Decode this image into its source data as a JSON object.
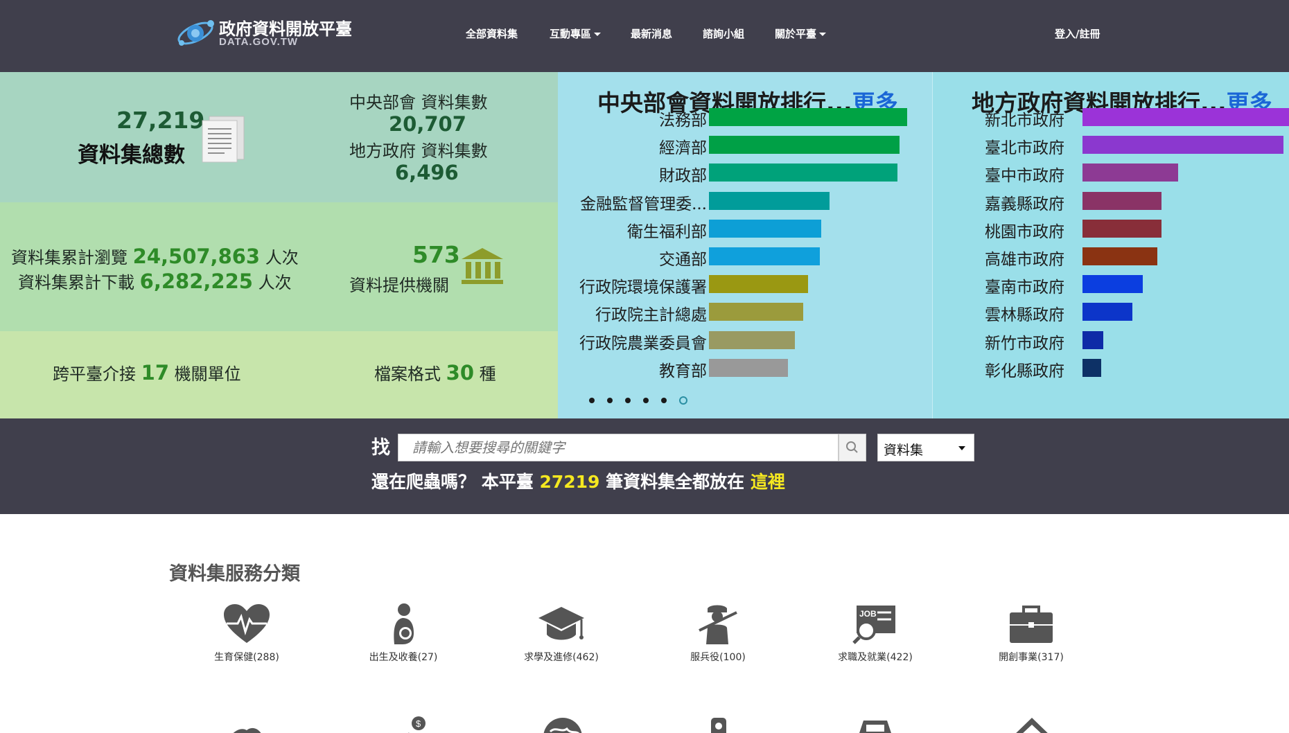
{
  "header": {
    "logo_title": "政府資料開放平臺",
    "logo_sub": "DATA.GOV.TW",
    "nav": [
      {
        "label": "全部資料集",
        "has_caret": false
      },
      {
        "label": "互動專區",
        "has_caret": true
      },
      {
        "label": "最新消息",
        "has_caret": false
      },
      {
        "label": "諮詢小組",
        "has_caret": false
      },
      {
        "label": "關於平臺",
        "has_caret": true
      }
    ],
    "login": "登入/註冊"
  },
  "stats": {
    "total_value": "27,219",
    "total_label": "資料集總數",
    "central_label": "中央部會 資料集數",
    "central_value": "20,707",
    "local_label": "地方政府 資料集數",
    "local_value": "6,496",
    "views_prefix": "資料集累計瀏覽",
    "views_value": "24,507,863",
    "views_suffix": "人次",
    "downloads_prefix": "資料集累計下載",
    "downloads_value": "6,282,225",
    "downloads_suffix": "人次",
    "agencies_value": "573",
    "agencies_label": "資料提供機關",
    "cross_prefix": "跨平臺介接",
    "cross_value": "17",
    "cross_suffix": "機關單位",
    "format_prefix": "檔案格式",
    "format_value": "30",
    "format_suffix": "種"
  },
  "ranking_central": {
    "title": "中央部會資料開放排行...",
    "more": "更多",
    "items": [
      {
        "label": "法務部",
        "value": 1.0,
        "color": "#00a344"
      },
      {
        "label": "經濟部",
        "value": 0.96,
        "color": "#00a046"
      },
      {
        "label": "財政部",
        "value": 0.95,
        "color": "#00a27a"
      },
      {
        "label": "金融監督管理委...",
        "value": 0.61,
        "color": "#019c9a"
      },
      {
        "label": "衛生福利部",
        "value": 0.565,
        "color": "#0d9fd6"
      },
      {
        "label": "交通部",
        "value": 0.56,
        "color": "#0fa0dc"
      },
      {
        "label": "行政院環境保護署",
        "value": 0.5,
        "color": "#9a9812"
      },
      {
        "label": "行政院主計總處",
        "value": 0.475,
        "color": "#9b9b3c"
      },
      {
        "label": "行政院農業委員會",
        "value": 0.435,
        "color": "#999a62"
      },
      {
        "label": "教育部",
        "value": 0.4,
        "color": "#999999"
      }
    ]
  },
  "ranking_local": {
    "title": "地方政府資料開放排行...",
    "more": "更多",
    "items": [
      {
        "label": "新北市政府",
        "value": 1.0,
        "color": "#9b33d8"
      },
      {
        "label": "臺北市政府",
        "value": 0.97,
        "color": "#8b38cf"
      },
      {
        "label": "臺中市政府",
        "value": 0.46,
        "color": "#8d3a94"
      },
      {
        "label": "嘉義縣政府",
        "value": 0.38,
        "color": "#8a3366"
      },
      {
        "label": "桃園市政府",
        "value": 0.38,
        "color": "#882e39"
      },
      {
        "label": "高雄市政府",
        "value": 0.36,
        "color": "#8a3312"
      },
      {
        "label": "臺南市政府",
        "value": 0.29,
        "color": "#0b3ee0"
      },
      {
        "label": "雲林縣政府",
        "value": 0.24,
        "color": "#0c35c9"
      },
      {
        "label": "新竹市政府",
        "value": 0.1,
        "color": "#0e2ba7"
      },
      {
        "label": "彰化縣政府",
        "value": 0.09,
        "color": "#0d3166"
      }
    ]
  },
  "carousel": {
    "count": 6,
    "active": 5
  },
  "search": {
    "label": "找",
    "placeholder": "請輸入想要搜尋的關鍵字",
    "select_value": "資料集",
    "promo_prefix": "還在爬蟲嗎？ 本平臺",
    "promo_count": "27219",
    "promo_middle": "筆資料集全都放在",
    "promo_link": "這裡"
  },
  "categories": {
    "title": "資料集服務分類",
    "items": [
      {
        "label": "生育保健(288)",
        "icon": "heart-pulse-icon"
      },
      {
        "label": "出生及收養(27)",
        "icon": "mother-baby-icon"
      },
      {
        "label": "求學及進修(462)",
        "icon": "graduation-cap-icon"
      },
      {
        "label": "服兵役(100)",
        "icon": "soldier-icon"
      },
      {
        "label": "求職及就業(422)",
        "icon": "job-search-icon"
      },
      {
        "label": "開創事業(317)",
        "icon": "briefcase-icon"
      }
    ]
  }
}
